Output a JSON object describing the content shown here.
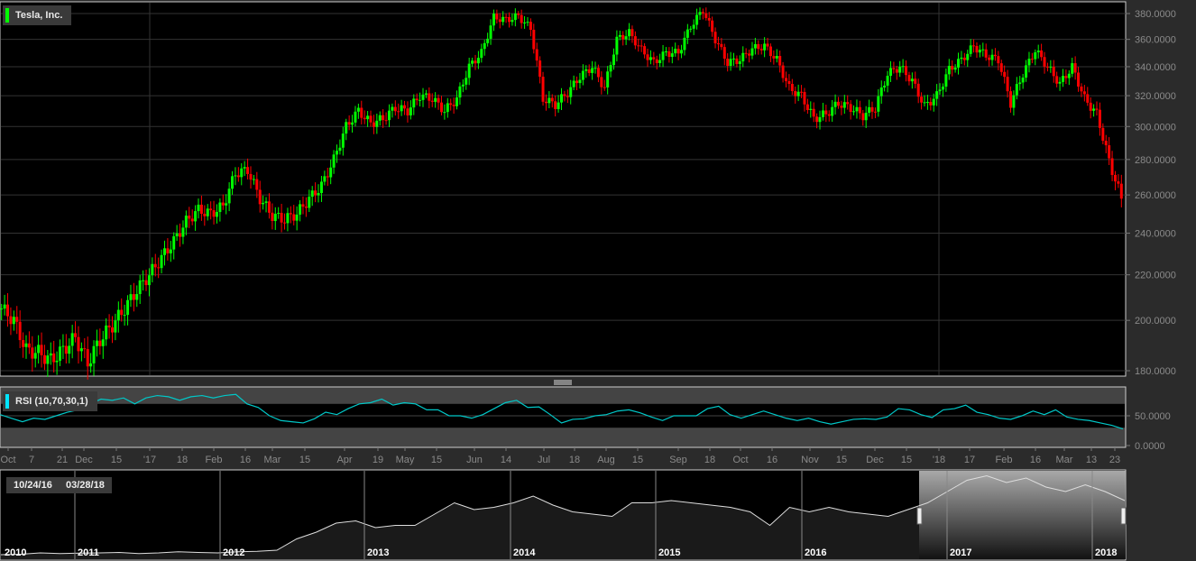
{
  "title": "Tesla, Inc.",
  "indicator_label": "RSI (10,70,30,1)",
  "range": {
    "start": "10/24/16",
    "end": "03/28/18"
  },
  "colors": {
    "up": "#00ff00",
    "down": "#ff0000",
    "rsi": "#00c8c8",
    "title_marker": "#00ff00",
    "rsi_marker": "#00e5ff"
  },
  "chart_data": [
    {
      "type": "candlestick",
      "title": "Tesla, Inc.",
      "yscale": "log",
      "ylim": [
        180,
        385
      ],
      "yticks": [
        "180.0000",
        "200.0000",
        "220.0000",
        "240.0000",
        "260.0000",
        "280.0000",
        "300.0000",
        "320.0000",
        "340.0000",
        "360.0000",
        "380.0000"
      ],
      "xticks": [
        "Oct",
        "7",
        "21",
        "Dec",
        "15",
        "'17",
        "18",
        "Feb",
        "16",
        "Mar",
        "15",
        "Apr",
        "19",
        "May",
        "15",
        "Jun",
        "14",
        "Jul",
        "18",
        "Aug",
        "15",
        "Sep",
        "18",
        "Oct",
        "16",
        "Nov",
        "15",
        "Dec",
        "15",
        "'18",
        "17",
        "Feb",
        "16",
        "Mar",
        "13",
        "23"
      ],
      "sessions_per_point": 4,
      "closes": [
        205,
        200,
        188,
        187,
        184,
        188,
        193,
        183,
        192,
        198,
        205,
        213,
        220,
        228,
        236,
        246,
        252,
        250,
        254,
        272,
        274,
        258,
        249,
        247,
        250,
        258,
        265,
        280,
        300,
        310,
        302,
        305,
        312,
        310,
        320,
        318,
        310,
        318,
        340,
        350,
        377,
        375,
        378,
        368,
        318,
        314,
        322,
        333,
        340,
        325,
        360,
        365,
        352,
        343,
        350,
        350,
        370,
        383,
        360,
        343,
        345,
        353,
        355,
        345,
        325,
        320,
        305,
        308,
        315,
        312,
        307,
        312,
        335,
        340,
        330,
        313,
        320,
        338,
        345,
        355,
        348,
        345,
        315,
        335,
        352,
        340,
        328,
        340,
        318,
        308,
        279,
        258
      ]
    },
    {
      "type": "line",
      "title": "RSI (10,70,30,1)",
      "ylim": [
        0,
        100
      ],
      "bands": [
        30,
        70
      ],
      "yticks": [
        "0.0000",
        "50.0000"
      ],
      "values": [
        52,
        46,
        40,
        46,
        44,
        50,
        56,
        60,
        70,
        78,
        76,
        80,
        70,
        80,
        84,
        82,
        76,
        82,
        84,
        80,
        84,
        86,
        70,
        64,
        50,
        42,
        40,
        38,
        45,
        56,
        52,
        62,
        70,
        72,
        78,
        68,
        72,
        70,
        60,
        60,
        50,
        50,
        46,
        52,
        62,
        72,
        76,
        64,
        65,
        52,
        38,
        44,
        45,
        50,
        52,
        58,
        60,
        55,
        48,
        42,
        50,
        50,
        50,
        62,
        66,
        52,
        46,
        52,
        58,
        52,
        46,
        42,
        46,
        40,
        36,
        40,
        44,
        45,
        44,
        48,
        62,
        60,
        52,
        47,
        60,
        62,
        68,
        56,
        52,
        46,
        44,
        50,
        58,
        52,
        60,
        48,
        44,
        42,
        38,
        34,
        28
      ]
    },
    {
      "type": "area",
      "title": "navigator",
      "ylim": [
        0,
        400
      ],
      "xticks": [
        "2010",
        "2011",
        "2012",
        "2013",
        "2014",
        "2015",
        "2016",
        "2017",
        "2018"
      ],
      "values": [
        20,
        22,
        28,
        25,
        27,
        28,
        30,
        25,
        28,
        33,
        30,
        28,
        33,
        35,
        40,
        90,
        120,
        160,
        170,
        140,
        150,
        150,
        200,
        250,
        220,
        230,
        250,
        280,
        240,
        210,
        200,
        190,
        250,
        250,
        260,
        250,
        240,
        230,
        210,
        150,
        230,
        210,
        230,
        210,
        200,
        190,
        220,
        250,
        300,
        350,
        370,
        340,
        360,
        320,
        300,
        330,
        300,
        260
      ],
      "selection": [
        "10/24/16",
        "03/28/18"
      ]
    }
  ]
}
